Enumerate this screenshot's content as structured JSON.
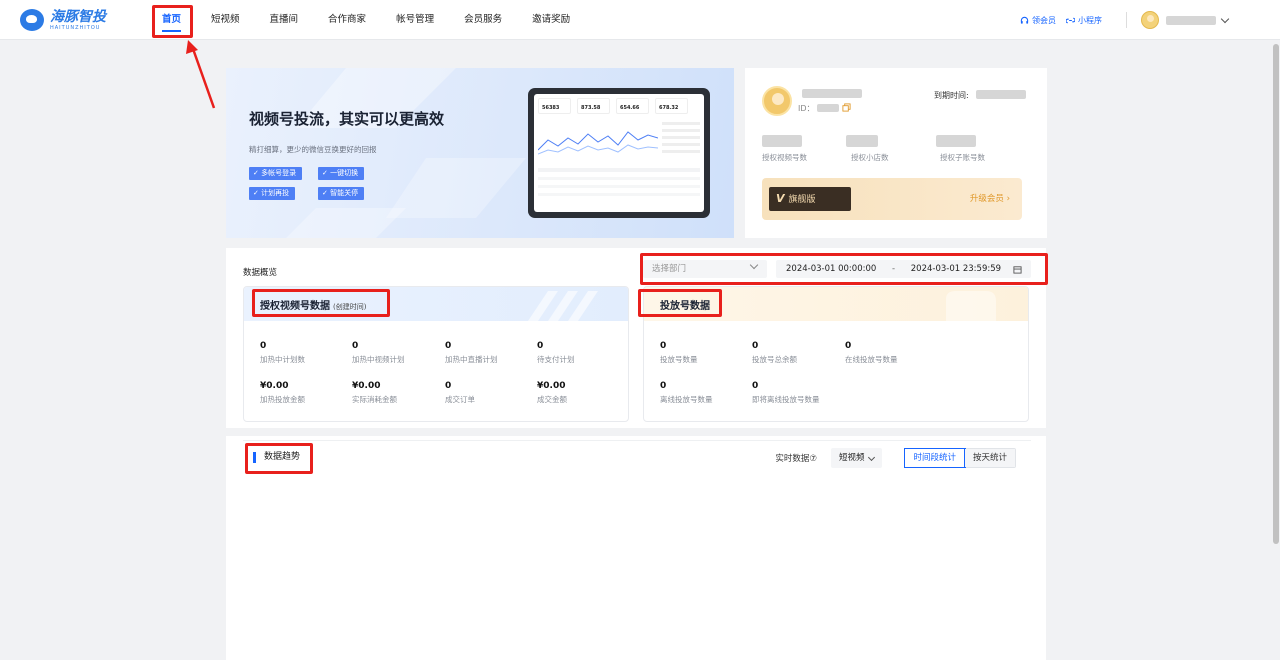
{
  "brand": {
    "name_cn": "海豚智投",
    "name_en": "HAITUNZHITOU"
  },
  "nav": [
    {
      "label": "首页",
      "active": true
    },
    {
      "label": "短视频"
    },
    {
      "label": "直播间"
    },
    {
      "label": "合作商家"
    },
    {
      "label": "帐号管理"
    },
    {
      "label": "会员服务"
    },
    {
      "label": "邀请奖励"
    }
  ],
  "topright": {
    "link1": "领会员",
    "link2": "小程序"
  },
  "banner": {
    "title": "视频号投流，其实可以更高效",
    "subtitle": "精打细算，更少的微信豆换更好的回报",
    "tags": [
      "多帐号登录",
      "一键切换",
      "计划再投",
      "智能关停"
    ],
    "tablet_stats": [
      "56383",
      "873.58",
      "654.66",
      "678.32"
    ]
  },
  "profile": {
    "id_label": "ID：",
    "expire_label": "到期时间:",
    "stats": [
      "授权视频号数",
      "授权小店数",
      "授权子账号数"
    ],
    "vip_mark": "V",
    "vip_name": "旗舰版",
    "vip_upgrade": "升级会员 ›"
  },
  "overview": {
    "title": "数据概览",
    "dept_placeholder": "选择部门",
    "date_start": "2024-03-01 00:00:00",
    "date_sep": "-",
    "date_end": "2024-03-01 23:59:59",
    "left": {
      "title": "授权视频号数据",
      "title_note": "(创建时间)",
      "stats": [
        {
          "value": "0",
          "label": "加热中计划数"
        },
        {
          "value": "0",
          "label": "加热中视频计划"
        },
        {
          "value": "0",
          "label": "加热中直播计划"
        },
        {
          "value": "0",
          "label": "待支付计划"
        },
        {
          "value": "¥0.00",
          "label": "加热投放金额"
        },
        {
          "value": "¥0.00",
          "label": "实际消耗金额"
        },
        {
          "value": "0",
          "label": "成交订单"
        },
        {
          "value": "¥0.00",
          "label": "成交金额"
        }
      ]
    },
    "right": {
      "title": "投放号数据",
      "stats": [
        {
          "value": "0",
          "label": "投放号数量"
        },
        {
          "value": "0",
          "label": "投放号总余额"
        },
        {
          "value": "0",
          "label": "在线投放号数量"
        },
        {
          "value": "0",
          "label": "离线投放号数量"
        },
        {
          "value": "0",
          "label": "即将离线投放号数量"
        }
      ]
    }
  },
  "trend": {
    "title": "数据趋势",
    "realtime_label": "实时数据⑦",
    "type_value": "短视频",
    "seg": [
      "时间段统计",
      "按天统计"
    ]
  }
}
